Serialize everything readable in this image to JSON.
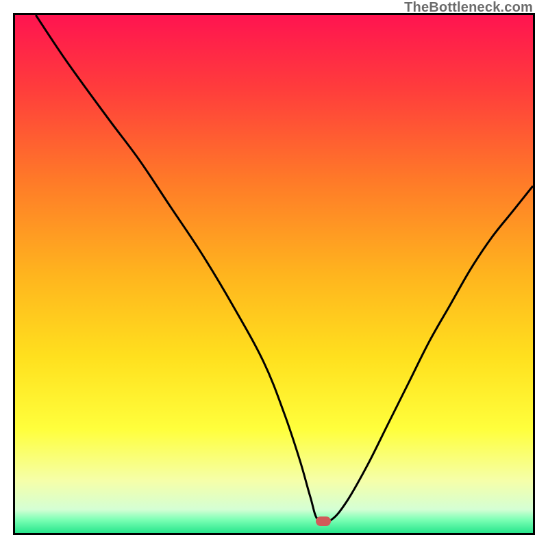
{
  "watermark": "TheBottleneck.com",
  "chart_data": {
    "type": "line",
    "title": "",
    "xlabel": "",
    "ylabel": "",
    "xlim": [
      0,
      100
    ],
    "ylim": [
      0,
      100
    ],
    "grid": false,
    "series": [
      {
        "name": "bottleneck-curve",
        "color": "#000000",
        "x": [
          4,
          10,
          18,
          24,
          30,
          36,
          42,
          48,
          52,
          55,
          57,
          58.5,
          61,
          64,
          68,
          72,
          76,
          80,
          84,
          88,
          92,
          96,
          100
        ],
        "y": [
          100,
          91,
          80,
          72,
          63,
          54,
          44,
          33,
          23,
          14,
          7,
          2.5,
          2.5,
          6,
          13,
          21,
          29,
          37,
          44,
          51,
          57,
          62,
          67
        ]
      }
    ],
    "marker": {
      "name": "bottleneck-point",
      "x": 59.5,
      "y": 2.3,
      "color": "#d05a5a"
    },
    "background_gradient": {
      "stops": [
        {
          "offset": 0.0,
          "color": "#ff1450"
        },
        {
          "offset": 0.14,
          "color": "#ff3c3c"
        },
        {
          "offset": 0.32,
          "color": "#ff7a28"
        },
        {
          "offset": 0.5,
          "color": "#ffb41e"
        },
        {
          "offset": 0.66,
          "color": "#ffe01e"
        },
        {
          "offset": 0.8,
          "color": "#ffff3c"
        },
        {
          "offset": 0.9,
          "color": "#f5ffaa"
        },
        {
          "offset": 0.955,
          "color": "#d4ffd4"
        },
        {
          "offset": 0.975,
          "color": "#7affb4"
        },
        {
          "offset": 1.0,
          "color": "#28e68c"
        }
      ]
    }
  }
}
